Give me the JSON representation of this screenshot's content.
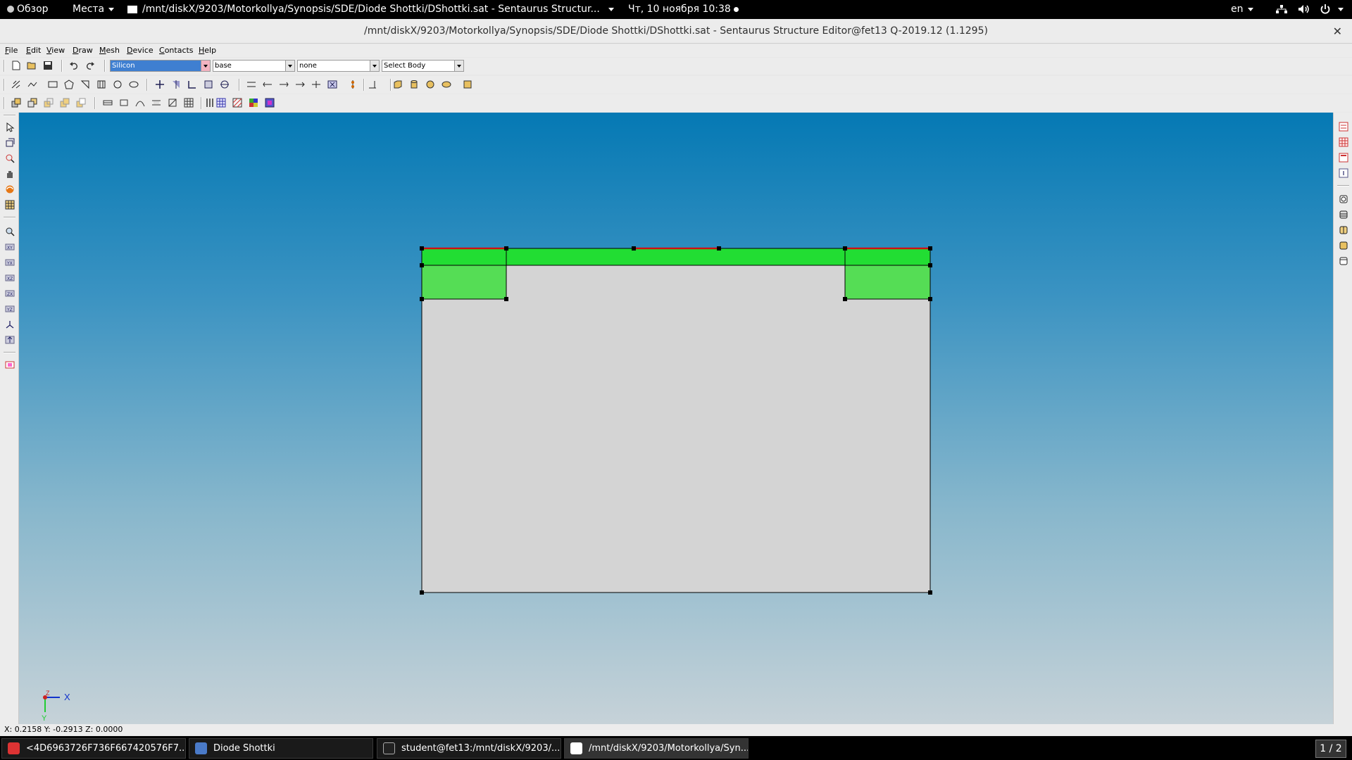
{
  "topbar": {
    "overview": "Обзор",
    "places": "Места",
    "window_title": "/mnt/diskX/9203/Motorkollya/Synopsis/SDE/Diode Shottki/DShottki.sat - Sentaurus Structur...",
    "clock": "Чт, 10 ноября  10:38",
    "lang": "en"
  },
  "titlebar": {
    "title": "/mnt/diskX/9203/Motorkollya/Synopsis/SDE/Diode Shottki/DShottki.sat - Sentaurus Structure Editor@fet13 Q-2019.12 (1.1295)",
    "close": "✕"
  },
  "menu": {
    "file": "File",
    "edit": "Edit",
    "view": "View",
    "draw": "Draw",
    "mesh": "Mesh",
    "device": "Device",
    "contacts": "Contacts",
    "help": "Help"
  },
  "toolbar": {
    "material": "Silicon",
    "region": "base",
    "contact": "none",
    "body": "Select Body"
  },
  "axes": {
    "x": "X",
    "y": "Y",
    "z": "Z"
  },
  "status": {
    "coords": "X: 0.2158 Y: -0.2913 Z: 0.0000"
  },
  "taskbar": {
    "items": [
      "<4D6963726F736F667420576F7...",
      "Diode Shottki",
      "student@fet13:/mnt/diskX/9203/...",
      "/mnt/diskX/9203/Motorkollya/Syn..."
    ],
    "pager": "1 / 2"
  },
  "colors": {
    "region_fill": "#d4d4d4",
    "doping_top": "#22dd33",
    "doping_guard": "#55dd55",
    "contact": "#d01010"
  }
}
